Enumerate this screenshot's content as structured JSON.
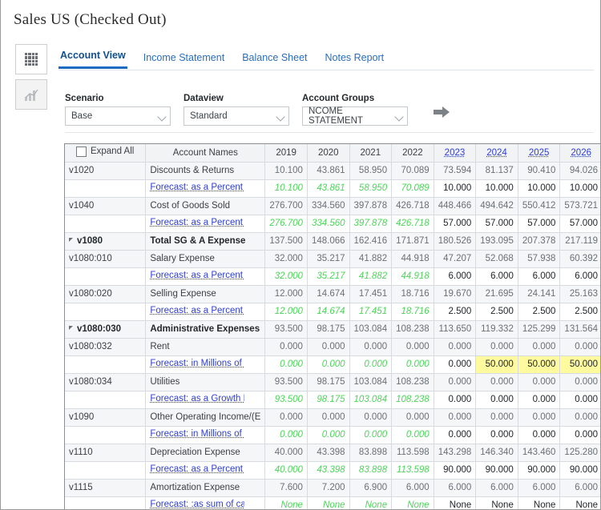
{
  "window": {
    "title": "Sales US (Checked Out)"
  },
  "rail": {
    "grid_icon": "grid-icon",
    "chart_icon": "chart-icon"
  },
  "tabs": [
    {
      "label": "Account View",
      "active": true
    },
    {
      "label": "Income Statement",
      "active": false
    },
    {
      "label": "Balance Sheet",
      "active": false
    },
    {
      "label": "Notes Report",
      "active": false
    }
  ],
  "filters": {
    "scenario": {
      "label": "Scenario",
      "value": "Base"
    },
    "dataview": {
      "label": "Dataview",
      "value": "Standard"
    },
    "account_groups": {
      "label": "Account Groups",
      "value": "NCOME STATEMENT"
    },
    "go_arrow": "arrow-right-icon"
  },
  "table": {
    "expand_all_label": "Expand All",
    "expand_all_checked": false,
    "account_names_header": "Account Names",
    "year_columns": [
      {
        "label": "2019",
        "link": false
      },
      {
        "label": "2020",
        "link": false
      },
      {
        "label": "2021",
        "link": false
      },
      {
        "label": "2022",
        "link": false
      },
      {
        "label": "2023",
        "link": true
      },
      {
        "label": "2024",
        "link": true
      },
      {
        "label": "2025",
        "link": true
      },
      {
        "label": "2026",
        "link": true
      }
    ],
    "rows": [
      {
        "id": "v1020",
        "name": "Discounts & Returns",
        "indent": 0,
        "bold": false,
        "triangle": false,
        "values": [
          "10.100",
          "43.861",
          "58.950",
          "70.089",
          "73.594",
          "81.137",
          "90.410",
          "94.026"
        ]
      },
      {
        "type": "forecast",
        "name": "Forecast: as a Percent of R",
        "hist_count": 4,
        "values": [
          "10.100",
          "43.861",
          "58.950",
          "70.089",
          "10.000",
          "10.000",
          "10.000",
          "10.000"
        ],
        "edited": []
      },
      {
        "id": "v1040",
        "name": "Cost of Goods Sold",
        "indent": 0,
        "bold": false,
        "triangle": false,
        "values": [
          "276.700",
          "334.560",
          "397.878",
          "426.718",
          "448.466",
          "494.642",
          "550.412",
          "573.721"
        ]
      },
      {
        "type": "forecast",
        "name": "Forecast: as a Percent of S",
        "hist_count": 4,
        "values": [
          "276.700",
          "334.560",
          "397.878",
          "426.718",
          "57.000",
          "57.000",
          "57.000",
          "57.000"
        ],
        "edited": []
      },
      {
        "id": "v1080",
        "name": "Total SG & A Expense",
        "indent": 0,
        "bold": true,
        "triangle": true,
        "values": [
          "137.500",
          "148.066",
          "162.416",
          "171.871",
          "180.526",
          "193.095",
          "207.378",
          "217.119"
        ]
      },
      {
        "id": "v1080:010",
        "name": "Salary Expense",
        "indent": 1,
        "bold": false,
        "triangle": false,
        "values": [
          "32.000",
          "35.217",
          "41.882",
          "44.918",
          "47.207",
          "52.068",
          "57.938",
          "60.392"
        ]
      },
      {
        "type": "forecast",
        "name": "Forecast: as a Percent of S",
        "hist_count": 4,
        "values": [
          "32.000",
          "35.217",
          "41.882",
          "44.918",
          "6.000",
          "6.000",
          "6.000",
          "6.000"
        ],
        "edited": []
      },
      {
        "id": "v1080:020",
        "name": "Selling Expense",
        "indent": 1,
        "bold": false,
        "triangle": false,
        "values": [
          "12.000",
          "14.674",
          "17.451",
          "18.716",
          "19.670",
          "21.695",
          "24.141",
          "25.163"
        ]
      },
      {
        "type": "forecast",
        "name": "Forecast: as a Percent of S",
        "hist_count": 4,
        "values": [
          "12.000",
          "14.674",
          "17.451",
          "18.716",
          "2.500",
          "2.500",
          "2.500",
          "2.500"
        ],
        "edited": []
      },
      {
        "id": "v1080:030",
        "name": "Administrative Expenses",
        "indent": 1,
        "bold": true,
        "triangle": true,
        "values": [
          "93.500",
          "98.175",
          "103.084",
          "108.238",
          "113.650",
          "119.332",
          "125.299",
          "131.564"
        ]
      },
      {
        "id": "v1080:032",
        "name": "Rent",
        "indent": 2,
        "bold": false,
        "triangle": false,
        "values": [
          "0.000",
          "0.000",
          "0.000",
          "0.000",
          "0.000",
          "0.000",
          "0.000",
          "0.000"
        ]
      },
      {
        "type": "forecast",
        "name": "Forecast: in Millions of US",
        "hist_count": 4,
        "values": [
          "0.000",
          "0.000",
          "0.000",
          "0.000",
          "0.000",
          "50.000",
          "50.000",
          "50.000"
        ],
        "edited": [
          5,
          6,
          7
        ]
      },
      {
        "id": "v1080:034",
        "name": "Utilities",
        "indent": 2,
        "bold": false,
        "triangle": false,
        "values": [
          "93.500",
          "98.175",
          "103.084",
          "108.238",
          "0.000",
          "0.000",
          "0.000",
          "0.000"
        ]
      },
      {
        "type": "forecast",
        "name": "Forecast: as a Growth Rate",
        "hist_count": 4,
        "values": [
          "93.500",
          "98.175",
          "103.084",
          "108.238",
          "0.000",
          "0.000",
          "0.000",
          "0.000"
        ],
        "edited": []
      },
      {
        "id": "v1090",
        "name": "Other Operating Income/(E",
        "indent": 0,
        "bold": false,
        "triangle": false,
        "values": [
          "0.000",
          "0.000",
          "0.000",
          "0.000",
          "0.000",
          "0.000",
          "0.000",
          "0.000"
        ]
      },
      {
        "type": "forecast",
        "name": "Forecast: in Millions of US",
        "hist_count": 4,
        "values": [
          "0.000",
          "0.000",
          "0.000",
          "0.000",
          "0.000",
          "0.000",
          "0.000",
          "0.000"
        ],
        "edited": []
      },
      {
        "id": "v1110",
        "name": "Depreciation Expense",
        "indent": 0,
        "bold": false,
        "triangle": false,
        "values": [
          "40.000",
          "43.398",
          "83.898",
          "113.598",
          "143.298",
          "146.340",
          "143.460",
          "125.280"
        ]
      },
      {
        "type": "forecast",
        "name": "Forecast: as a Percent of D",
        "hist_count": 4,
        "values": [
          "40.000",
          "43.398",
          "83.898",
          "113.598",
          "90.000",
          "90.000",
          "90.000",
          "90.000"
        ],
        "edited": []
      },
      {
        "id": "v1115",
        "name": "Amortization Expense",
        "indent": 0,
        "bold": false,
        "triangle": false,
        "values": [
          "7.600",
          "7.200",
          "6.900",
          "6.000",
          "6.000",
          "6.000",
          "6.000",
          "6.000"
        ]
      },
      {
        "type": "forecast",
        "name": "Forecast: :as sum of cash",
        "hist_count": 4,
        "values": [
          "None",
          "None",
          "None",
          "None",
          "None",
          "None",
          "None",
          "None"
        ],
        "edited": []
      }
    ]
  },
  "colors": {
    "accent": "#1b6cc0",
    "link": "#2f3fd0",
    "historical": "#4dd45a",
    "edited_cell": "#fffa9e"
  }
}
